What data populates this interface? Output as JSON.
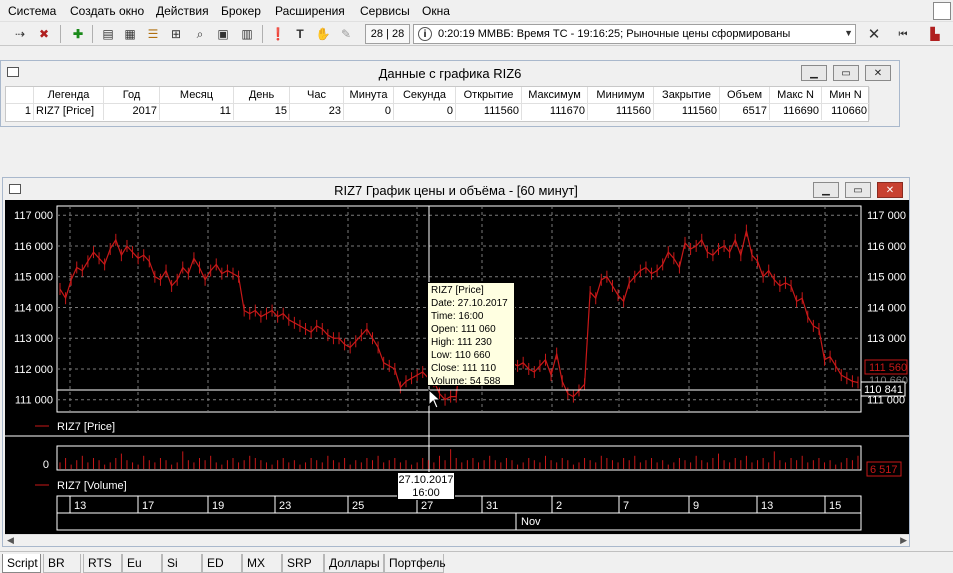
{
  "menu": [
    "Система",
    "Создать окно",
    "Действия",
    "Брокер",
    "Расширения",
    "Сервисы",
    "Окна"
  ],
  "toolbar": {
    "counter": "28 | 28",
    "status_text": "0:20:19  ММВБ: Время ТС - 19:16:25; Рыночные цены сформированы"
  },
  "data_window": {
    "title": "Данные с графика RIZ6",
    "columns": [
      "",
      "Легенда",
      "Год",
      "Месяц",
      "День",
      "Час",
      "Минута",
      "Секунда",
      "Открытие",
      "Максимум",
      "Минимум",
      "Закрытие",
      "Объем",
      "Макс N",
      "Мин N"
    ],
    "row": [
      "1",
      "RIZ7 [Price]",
      "2017",
      "11",
      "15",
      "23",
      "0",
      "0",
      "111560",
      "111670",
      "111560",
      "111560",
      "6517",
      "116690",
      "110660"
    ]
  },
  "chart_window": {
    "title": "RIZ7 График цены и объёма - [60 минут]",
    "price_legend": "RIZ7 [Price]",
    "volume_legend": "RIZ7 [Volume]",
    "volume_zero": "0",
    "current_price": "111 560",
    "cursor_price": "110 841",
    "hidden_price": "110 660",
    "current_volume": "6 517",
    "month_label": "Nov",
    "tooltip": {
      "l1": "RIZ7 [Price]",
      "l2": "Date: 27.10.2017",
      "l3": "Time: 16:00",
      "l4": "Open:  111 060",
      "l5": "High:   111 230",
      "l6": "Low:    110 660",
      "l7": "Close: 111 110",
      "l8": "Volume: 54 588"
    },
    "date_tip": {
      "date": "27.10.2017",
      "time": "16:00"
    }
  },
  "tabs": [
    "Script",
    "BR",
    "RTS",
    "Eu",
    "Si",
    "ED",
    "MX",
    "SRP",
    "Доллары",
    "Портфель"
  ],
  "colors": {
    "price": "#c81818",
    "grid": "#7a7a7a",
    "background": "#000000",
    "axis_text": "#ffffff"
  },
  "chart_data": {
    "type": "line",
    "y_ticks": [
      "117 000",
      "116 000",
      "115 000",
      "114 000",
      "113 000",
      "112 000",
      "111 000"
    ],
    "ylim": [
      110600,
      117300
    ],
    "x_ticks": [
      "13",
      "17",
      "19",
      "23",
      "25",
      "27",
      "31",
      "2",
      "7",
      "9",
      "13",
      "15"
    ],
    "series": [
      {
        "name": "RIZ7 [Price]",
        "values": [
          114600,
          114300,
          114900,
          115300,
          115200,
          115500,
          115800,
          115600,
          115400,
          115900,
          116200,
          115700,
          116000,
          115800,
          115600,
          115700,
          115500,
          115000,
          114900,
          115200,
          114700,
          114900,
          115300,
          115100,
          115600,
          115300,
          114900,
          115200,
          115400,
          115100,
          115200,
          115100,
          115000,
          113900,
          113800,
          113900,
          113700,
          113800,
          113900,
          113700,
          113800,
          113600,
          113500,
          113400,
          113300,
          113200,
          113400,
          113300,
          113100,
          113000,
          113000,
          112800,
          112700,
          112900,
          113100,
          113300,
          113000,
          112700,
          112200,
          112100,
          112000,
          111400,
          111600,
          111700,
          111800,
          111900,
          111700,
          111600,
          111200,
          111000,
          111100,
          111100,
          112800,
          112600,
          112500,
          112400,
          112400,
          112600,
          113000,
          112400,
          112300,
          112200,
          112100,
          112200,
          112000,
          111900,
          112100,
          112300,
          111800,
          112500,
          111600,
          111200,
          111100,
          111300,
          111500,
          114500,
          114300,
          114900,
          115000,
          114700,
          114400,
          114200,
          114800,
          115000,
          115200,
          115300,
          115100,
          115200,
          115400,
          115800,
          115600,
          115300,
          116100,
          115900,
          116000,
          116200,
          115800,
          115700,
          115900,
          116000,
          115800,
          116200,
          115700,
          116500,
          115700,
          115500,
          115000,
          115200,
          114900,
          114700,
          114800,
          114700,
          114200,
          114300,
          113700,
          113400,
          113300,
          112300,
          112400,
          112100,
          111800,
          111700,
          111600,
          111560
        ]
      },
      {
        "name": "RIZ7 [Volume]",
        "values": [
          3,
          5,
          2,
          4,
          6,
          3,
          5,
          4,
          2,
          3,
          5,
          7,
          4,
          3,
          2,
          6,
          4,
          3,
          5,
          4,
          2,
          3,
          8,
          4,
          3,
          5,
          4,
          6,
          3,
          2,
          4,
          5,
          3,
          4,
          6,
          5,
          4,
          3,
          2,
          4,
          5,
          3,
          4,
          2,
          3,
          5,
          4,
          3,
          6,
          4,
          3,
          5,
          2,
          4,
          3,
          5,
          4,
          6,
          3,
          4,
          5,
          3,
          4,
          2,
          3,
          5,
          4,
          3,
          6,
          4,
          9,
          5,
          3,
          4,
          5,
          3,
          4,
          6,
          4,
          3,
          5,
          4,
          2,
          3,
          5,
          4,
          3,
          6,
          4,
          3,
          5,
          4,
          2,
          3,
          5,
          4,
          3,
          6,
          5,
          4,
          3,
          5,
          4,
          6,
          3,
          4,
          5,
          3,
          4,
          2,
          3,
          5,
          4,
          3,
          6,
          4,
          3,
          5,
          7,
          4,
          3,
          5,
          4,
          6,
          3,
          4,
          5,
          3,
          8,
          4,
          3,
          5,
          4,
          6,
          3,
          4,
          5,
          3,
          4,
          2,
          3,
          5,
          4,
          6
        ]
      }
    ]
  }
}
